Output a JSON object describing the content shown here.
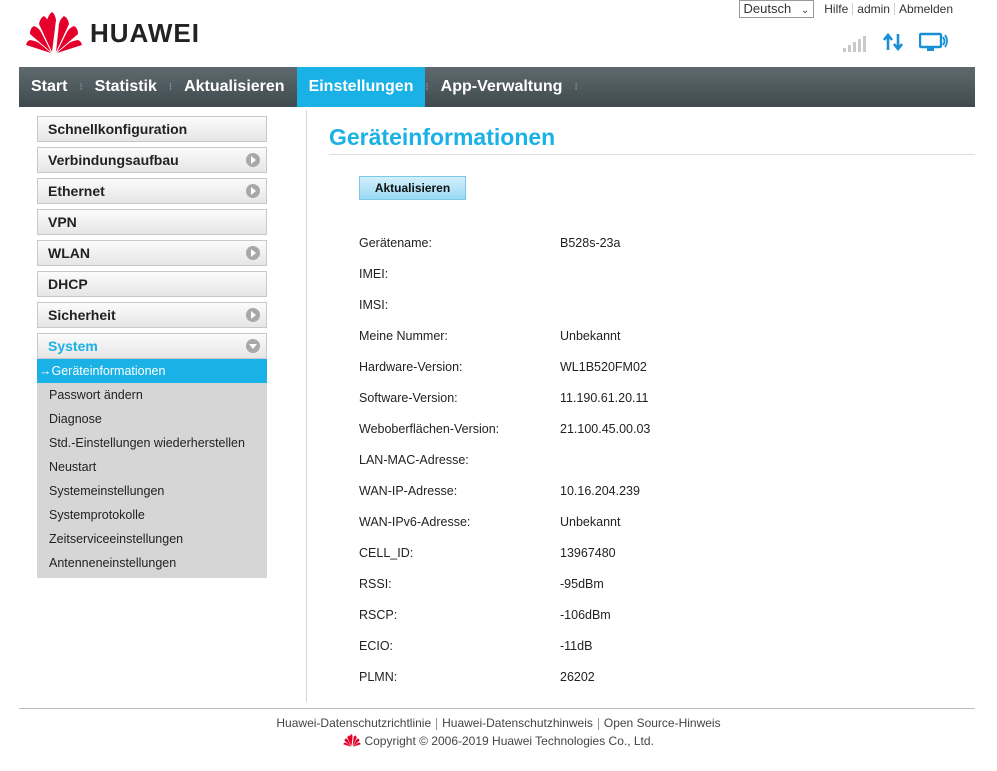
{
  "topbar": {
    "language": "Deutsch",
    "help": "Hilfe",
    "user": "admin",
    "logout": "Abmelden"
  },
  "brand": {
    "name": "HUAWEI",
    "logo_color": "#e4002b"
  },
  "status_icons": [
    "signal-strength-icon",
    "data-transfer-icon",
    "connected-pc-icon"
  ],
  "nav": {
    "items": [
      "Start",
      "Statistik",
      "Aktualisieren",
      "Einstellungen",
      "App-Verwaltung"
    ],
    "active": "Einstellungen"
  },
  "sidebar": {
    "menus": [
      {
        "label": "Schnellkonfiguration",
        "has_arrow": false
      },
      {
        "label": "Verbindungsaufbau",
        "has_arrow": true
      },
      {
        "label": "Ethernet",
        "has_arrow": true
      },
      {
        "label": "VPN",
        "has_arrow": false
      },
      {
        "label": "WLAN",
        "has_arrow": true
      },
      {
        "label": "DHCP",
        "has_arrow": false
      },
      {
        "label": "Sicherheit",
        "has_arrow": true
      },
      {
        "label": "System",
        "has_arrow": true,
        "open": true
      }
    ],
    "submenu": [
      "→Geräteinformationen",
      "Passwort ändern",
      "Diagnose",
      "Std.-Einstellungen wiederherstellen",
      "Neustart",
      "Systemeinstellungen",
      "Systemprotokolle",
      "Zeitserviceeinstellungen",
      "Antenneneinstellungen"
    ]
  },
  "main": {
    "title": "Geräteinformationen",
    "refresh_button": "Aktualisieren",
    "info": [
      {
        "label": "Gerätename:",
        "value": "B528s-23a"
      },
      {
        "label": "IMEI:",
        "value": ""
      },
      {
        "label": "IMSI:",
        "value": ""
      },
      {
        "label": "Meine Nummer:",
        "value": "Unbekannt"
      },
      {
        "label": "Hardware-Version:",
        "value": "WL1B520FM02"
      },
      {
        "label": "Software-Version:",
        "value": "11.190.61.20.11"
      },
      {
        "label": "Weboberflächen-Version:",
        "value": "21.100.45.00.03"
      },
      {
        "label": "LAN-MAC-Adresse:",
        "value": ""
      },
      {
        "label": "WAN-IP-Adresse:",
        "value": "10.16.204.239"
      },
      {
        "label": "WAN-IPv6-Adresse:",
        "value": "Unbekannt"
      },
      {
        "label": "CELL_ID:",
        "value": "13967480"
      },
      {
        "label": "RSSI:",
        "value": "-95dBm"
      },
      {
        "label": "RSCP:",
        "value": "-106dBm"
      },
      {
        "label": "ECIO:",
        "value": "-11dB"
      },
      {
        "label": "PLMN:",
        "value": "26202"
      }
    ]
  },
  "footer": {
    "links": [
      "Huawei-Datenschutzrichtlinie",
      "Huawei-Datenschutzhinweis",
      "Open Source-Hinweis"
    ],
    "copyright": "Copyright © 2006-2019 Huawei Technologies Co., Ltd."
  },
  "colors": {
    "accent": "#1ab1e6",
    "nav_bg": "#4a5559"
  }
}
